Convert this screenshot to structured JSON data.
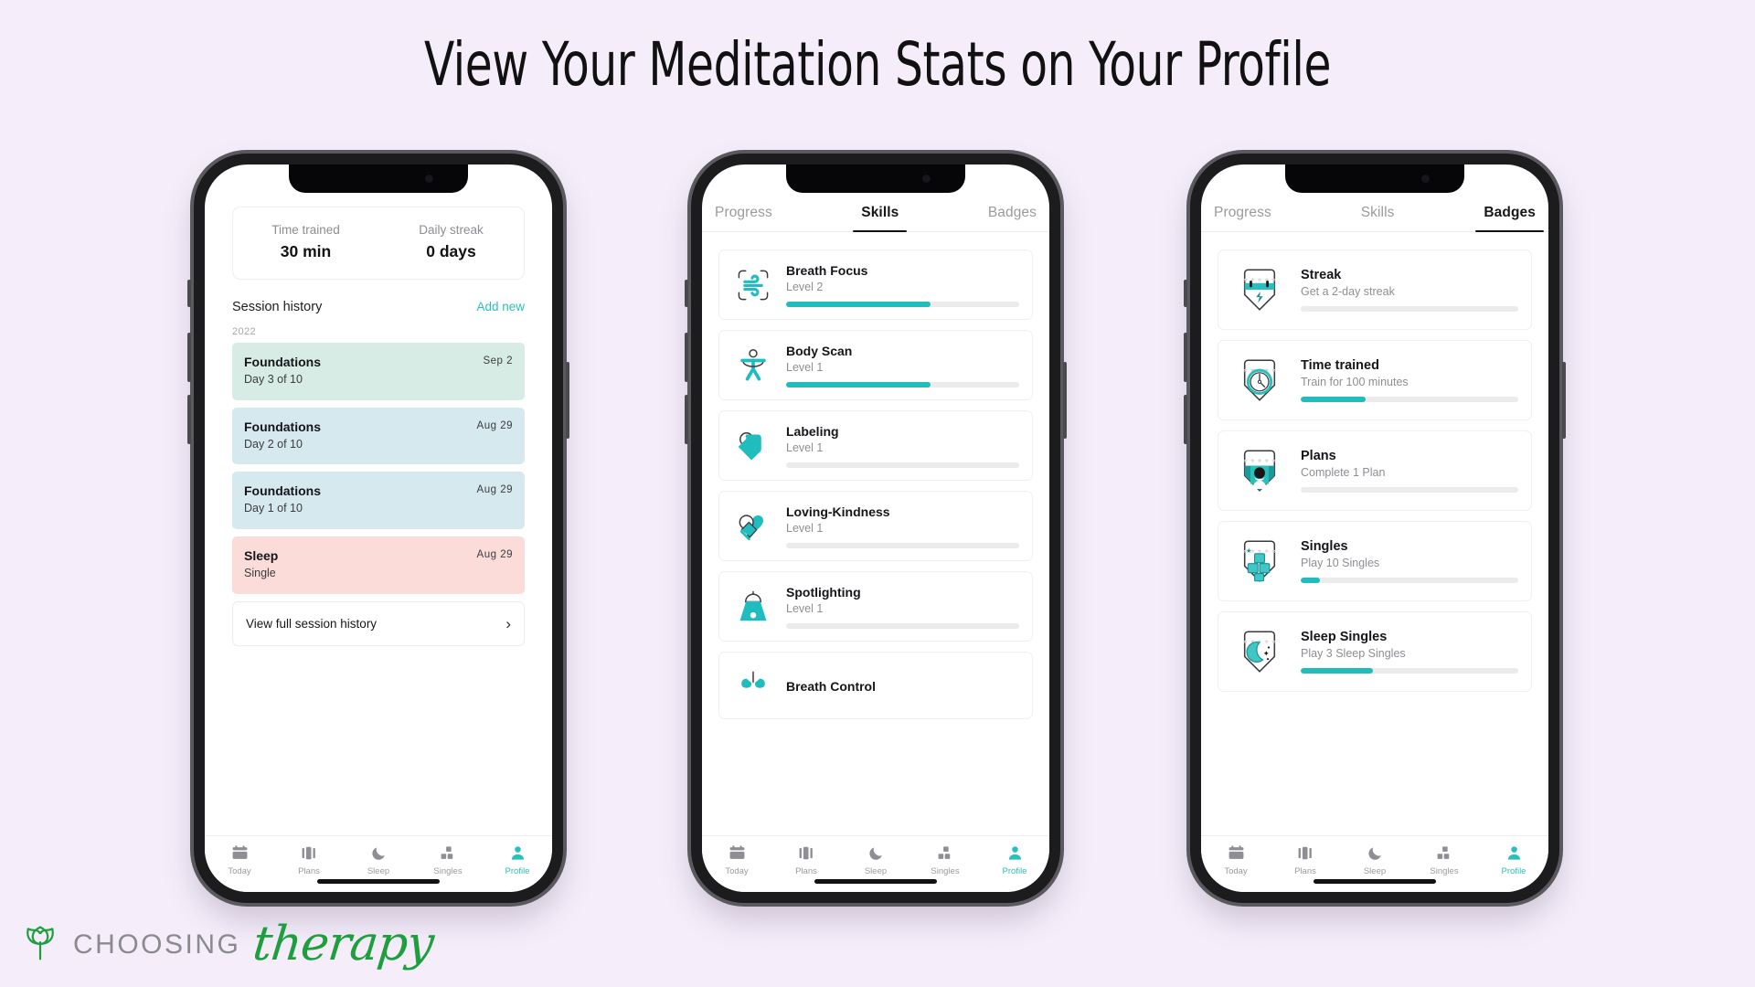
{
  "headline": "View Your Meditation Stats on Your Profile",
  "colors": {
    "background": "#f5eefa",
    "accent": "#2bbfbb",
    "progress": "#21bcbc",
    "card_green": "#d7ece4",
    "card_blue": "#d6e9ee",
    "card_pink": "#fcdcd8",
    "logo_green": "#1f9e3e"
  },
  "tabbar": {
    "items": [
      {
        "label": "Today",
        "icon": "calendar-icon",
        "active": false
      },
      {
        "label": "Plans",
        "icon": "plans-icon",
        "active": false
      },
      {
        "label": "Sleep",
        "icon": "moon-icon",
        "active": false
      },
      {
        "label": "Singles",
        "icon": "blocks-icon",
        "active": false
      },
      {
        "label": "Profile",
        "icon": "person-icon",
        "active": true
      }
    ]
  },
  "phone1": {
    "stats": [
      {
        "label": "Time trained",
        "value": "30 min"
      },
      {
        "label": "Daily streak",
        "value": "0 days"
      }
    ],
    "section": {
      "title": "Session history",
      "action": "Add new",
      "year": "2022"
    },
    "sessions": [
      {
        "title": "Foundations",
        "subtitle": "Day 3 of 10",
        "date": "Sep 2",
        "color": "#d7ece4"
      },
      {
        "title": "Foundations",
        "subtitle": "Day 2 of 10",
        "date": "Aug 29",
        "color": "#d6e9ee"
      },
      {
        "title": "Foundations",
        "subtitle": "Day 1 of 10",
        "date": "Aug 29",
        "color": "#d6e9ee"
      },
      {
        "title": "Sleep",
        "subtitle": "Single",
        "date": "Aug 29",
        "color": "#fcdcd8"
      }
    ],
    "view_full": {
      "label": "View full session history",
      "icon": "chevron-right-icon"
    }
  },
  "phone2": {
    "tabs": [
      {
        "label": "Progress",
        "active": false
      },
      {
        "label": "Skills",
        "active": true
      },
      {
        "label": "Badges",
        "active": false
      }
    ],
    "skills": [
      {
        "name": "Breath Focus",
        "level": "Level 2",
        "progress": 62,
        "icon": "breath-focus-icon"
      },
      {
        "name": "Body Scan",
        "level": "Level 1",
        "progress": 62,
        "icon": "body-scan-icon"
      },
      {
        "name": "Labeling",
        "level": "Level 1",
        "progress": 0,
        "icon": "labeling-tag-icon"
      },
      {
        "name": "Loving-Kindness",
        "level": "Level 1",
        "progress": 0,
        "icon": "handshake-heart-icon"
      },
      {
        "name": "Spotlighting",
        "level": "Level 1",
        "progress": 0,
        "icon": "spotlight-icon"
      },
      {
        "name": "Breath Control",
        "level": "",
        "progress": 0,
        "icon": "breath-control-icon"
      }
    ]
  },
  "phone3": {
    "tabs": [
      {
        "label": "Progress",
        "active": false
      },
      {
        "label": "Skills",
        "active": false
      },
      {
        "label": "Badges",
        "active": true
      }
    ],
    "badges": [
      {
        "name": "Streak",
        "desc": "Get a 2-day streak",
        "progress": 0,
        "icon": "badge-calendar-icon"
      },
      {
        "name": "Time trained",
        "desc": "Train for 100 minutes",
        "progress": 30,
        "icon": "badge-clock-icon"
      },
      {
        "name": "Plans",
        "desc": "Complete 1 Plan",
        "progress": 0,
        "icon": "badge-person-icon"
      },
      {
        "name": "Singles",
        "desc": "Play 10 Singles",
        "progress": 9,
        "icon": "badge-blocks-icon"
      },
      {
        "name": "Sleep Singles",
        "desc": "Play 3 Sleep Singles",
        "progress": 33,
        "icon": "badge-moon-icon"
      }
    ]
  },
  "logo": {
    "word": "CHOOSING",
    "script": "therapy",
    "icon": "leaf-icon"
  }
}
